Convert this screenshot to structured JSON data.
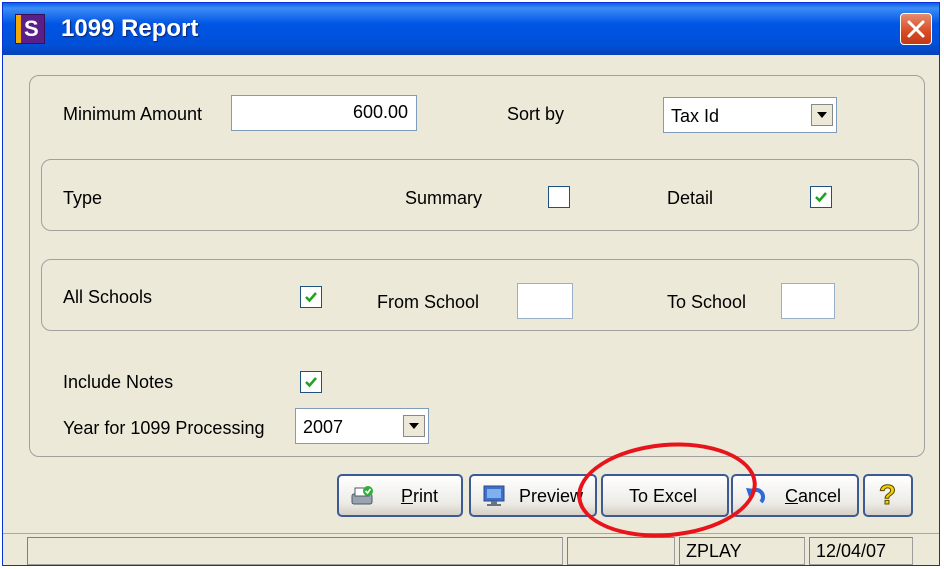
{
  "window": {
    "title": "1099 Report",
    "app_icon_letter": "S"
  },
  "fields": {
    "minimum_amount_label": "Minimum Amount",
    "minimum_amount_value": "600.00",
    "sort_by_label": "Sort by",
    "sort_by_value": "Tax Id"
  },
  "type_group": {
    "label": "Type",
    "summary_label": "Summary",
    "summary_checked": false,
    "detail_label": "Detail",
    "detail_checked": true
  },
  "schools_group": {
    "all_schools_label": "All Schools",
    "all_schools_checked": true,
    "from_school_label": "From School",
    "from_school_value": "",
    "to_school_label": "To School",
    "to_school_value": ""
  },
  "options": {
    "include_notes_label": "Include Notes",
    "include_notes_checked": true,
    "year_label": "Year for 1099 Processing",
    "year_value": "2007"
  },
  "buttons": {
    "print": "Print",
    "preview": "Preview",
    "to_excel": "To Excel",
    "cancel": "Cancel",
    "help": "?"
  },
  "statusbar": {
    "cell_user": "ZPLAY",
    "cell_date": "12/04/07"
  },
  "annotation": {
    "shape": "ellipse",
    "color": "#e8141c",
    "highlights": "to_excel"
  },
  "icons": [
    "close-icon",
    "printer-icon",
    "monitor-icon",
    "undo-icon",
    "question-icon",
    "checkmark-icon",
    "dropdown-arrow-icon"
  ]
}
